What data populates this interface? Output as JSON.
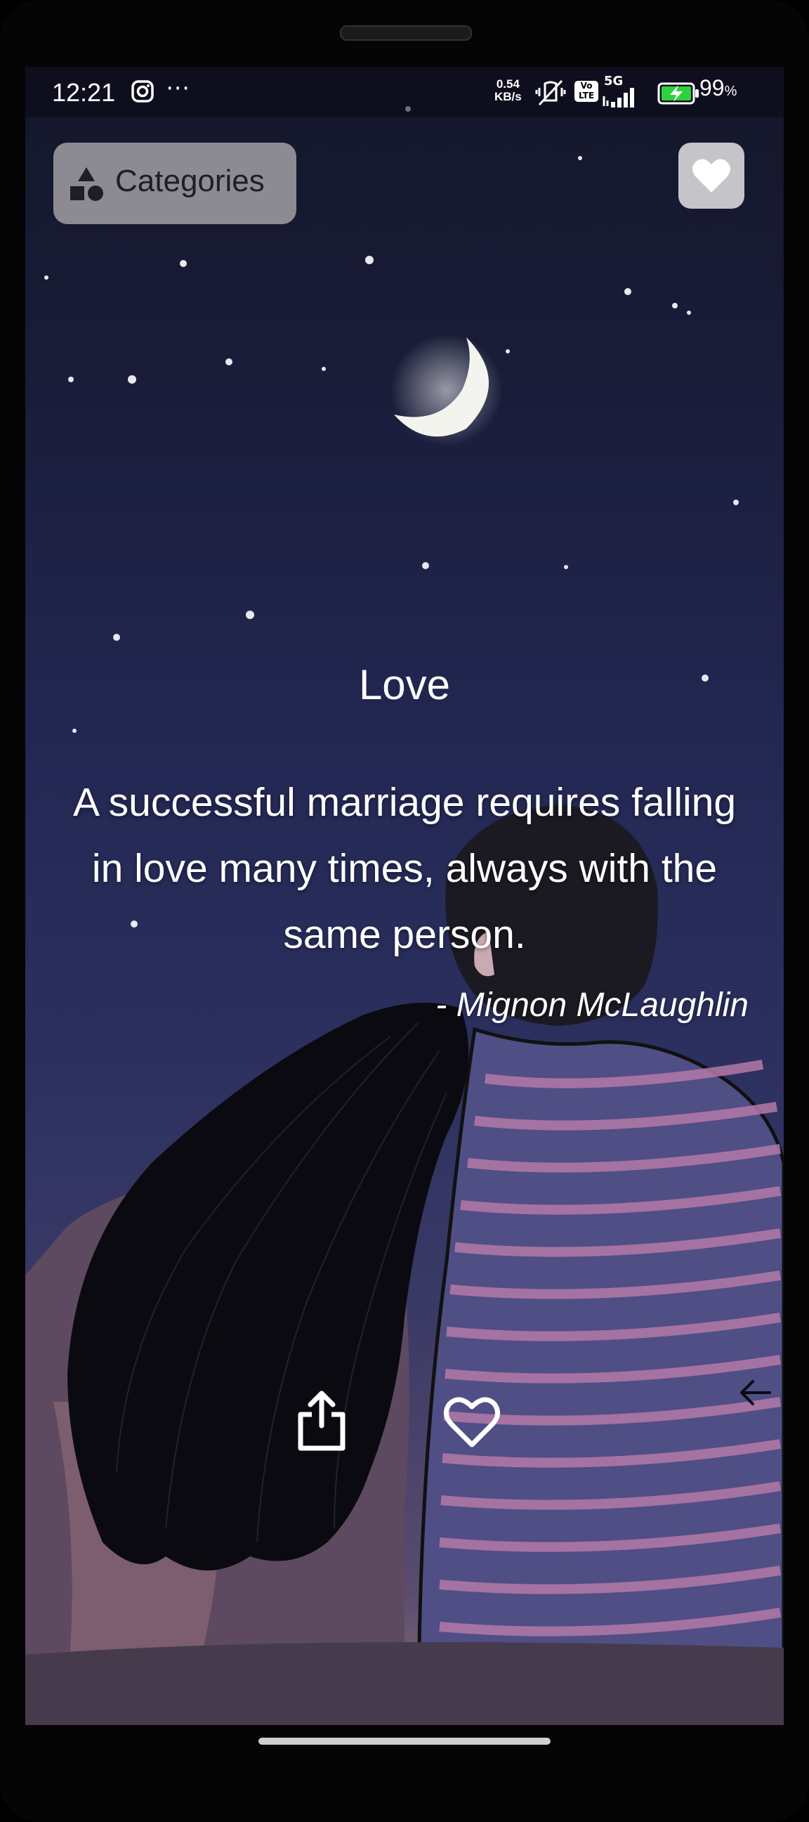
{
  "status_bar": {
    "time": "12:21",
    "speed_value": "0.54",
    "speed_unit": "KB/s",
    "volte": "Vo LTE",
    "network": "5G",
    "battery": "99",
    "battery_unit": "%"
  },
  "header": {
    "categories_label": "Categories"
  },
  "quote": {
    "category": "Love",
    "text": "A successful marriage requires falling in love many times, always with the same person.",
    "author": "- Mignon McLaughlin"
  },
  "colors": {
    "sky_top": "#141629",
    "sky_mid": "#2b2f5e",
    "categories_button": "#8d8b92",
    "favorite_button": "#c5c4c9",
    "text": "#ffffff"
  },
  "icons": {
    "categories": "shapes-icon",
    "favorites": "heart-filled-icon",
    "share": "share-icon",
    "like": "heart-outline-icon",
    "back": "arrow-left-icon"
  }
}
